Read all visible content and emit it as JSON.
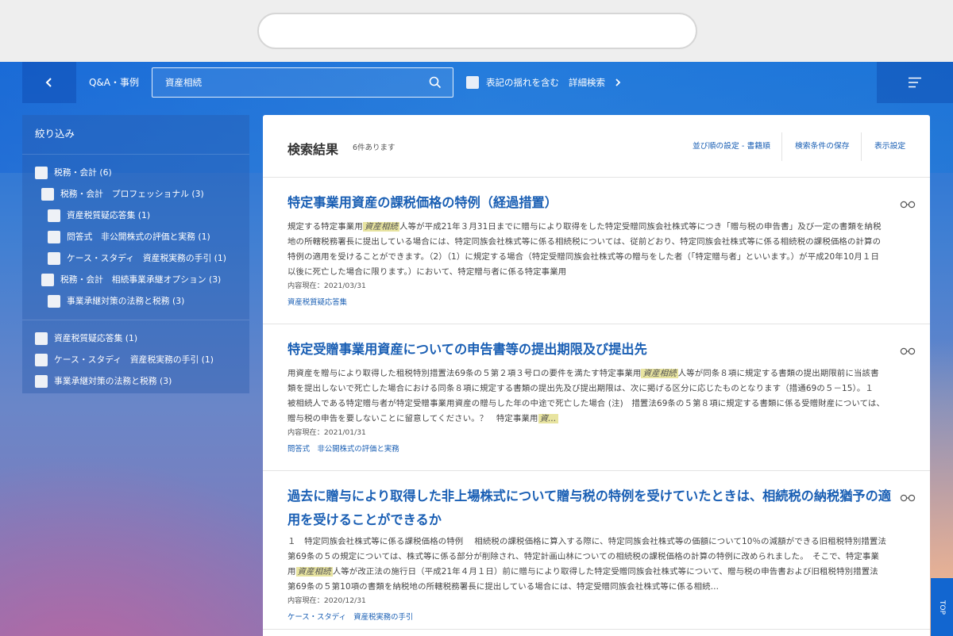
{
  "topbar": {
    "section_label": "Q&A・事例",
    "search_value": "資産相続",
    "variant_label": "表記の揺れを含む",
    "advanced_search_label": "詳細検索"
  },
  "sidebar": {
    "title": "絞り込み",
    "group1": [
      {
        "label": "税務・会計 (6)",
        "level": 0
      },
      {
        "label": "税務・会計　プロフェッショナル (3)",
        "level": 1
      },
      {
        "label": "資産税質疑応答集 (1)",
        "level": 2
      },
      {
        "label": "問答式　非公開株式の評価と実務 (1)",
        "level": 2
      },
      {
        "label": "ケース・スタディ　資産税実務の手引 (1)",
        "level": 2
      },
      {
        "label": "税務・会計　相続事業承継オプション (3)",
        "level": 1
      },
      {
        "label": "事業承継対策の法務と税務 (3)",
        "level": 2
      }
    ],
    "group2": [
      {
        "label": "資産税質疑応答集 (1)",
        "level": 0
      },
      {
        "label": "ケース・スタディ　資産税実務の手引 (1)",
        "level": 0
      },
      {
        "label": "事業承継対策の法務と税務 (3)",
        "level": 0
      }
    ]
  },
  "results": {
    "title": "検索結果",
    "count": "6件あります",
    "sort_label": "並び順の設定 - 書籍順",
    "save_label": "検索条件の保存",
    "display_label": "表示設定",
    "items": [
      {
        "title": "特定事業用資産の課税価格の特例（経過措置）",
        "snippet_before": "規定する特定事業用",
        "highlight": "資産相続",
        "snippet_after": "人等が平成21年３月31日までに贈与により取得をした特定受贈同族会社株式等につき「贈与税の申告書」及び一定の書類を納税地の所轄税務署長に提出している場合には、特定同族会社株式等に係る相続税については、従前どおり、特定同族会社株式等に係る相続税の課税価格の計算の特例の適用を受けることができます。（2）（1）に規定する場合（特定受贈同族会社株式等の贈与をした者（「特定贈与者」といいます。）が平成20年10月１日以後に死亡した場合に限ります。）において、特定贈与者に係る特定事業用",
        "date": "内容現在：2021/03/31",
        "source": "資産税質疑応答集"
      },
      {
        "title": "特定受贈事業用資産についての申告書等の提出期限及び提出先",
        "snippet_before": "用資産を贈与により取得した租税特別措置法69条の５第２項３号ロの要件を満たす特定事業用",
        "highlight": "資産相続",
        "snippet_after": "人等が同条８項に規定する書類の提出期限前に当該書類を提出しないで死亡した場合における同条８項に規定する書類の提出先及び提出期限は、次に掲げる区分に応じたものとなります（措通69の５－15）。１　被相続人である特定贈与者が特定受贈事業用資産の贈与した年の中途で死亡した場合 (注)　措置法69条の５第８項に規定する書類に係る受贈財産については、贈与税の申告を要しないことに留意してください。？　特定事業用",
        "highlight_tail": "資…",
        "date": "内容現在：2021/01/31",
        "source": "問答式　非公開株式の評価と実務"
      },
      {
        "title": "過去に贈与により取得した非上場株式について贈与税の特例を受けていたときは、相続税の納税猶予の適用を受けることができるか",
        "snippet_before": "１　特定同族会社株式等に係る課税価格の特例　 相続税の課税価格に算入する際に、特定同族会社株式等の価額について10％の減額ができる旧租税特別措置法第69条の５の規定については、株式等に係る部分が削除され、特定計画山林についての相続税の課税価格の計算の特例に改められました。　そこで、特定事業用",
        "highlight": "資産相続",
        "snippet_after": "人等が改正法の施行日（平成21年４月１日）前に贈与により取得した特定受贈同族会社株式等について、贈与税の申告書および旧租税特別措置法第69条の５第10項の書類を納税地の所轄税務署長に提出している場合には、特定受贈同族会社株式等に係る相続…",
        "date": "内容現在：2020/12/31",
        "source": "ケース・スタディ　資産税実務の手引"
      }
    ]
  },
  "top_button": "TOP"
}
